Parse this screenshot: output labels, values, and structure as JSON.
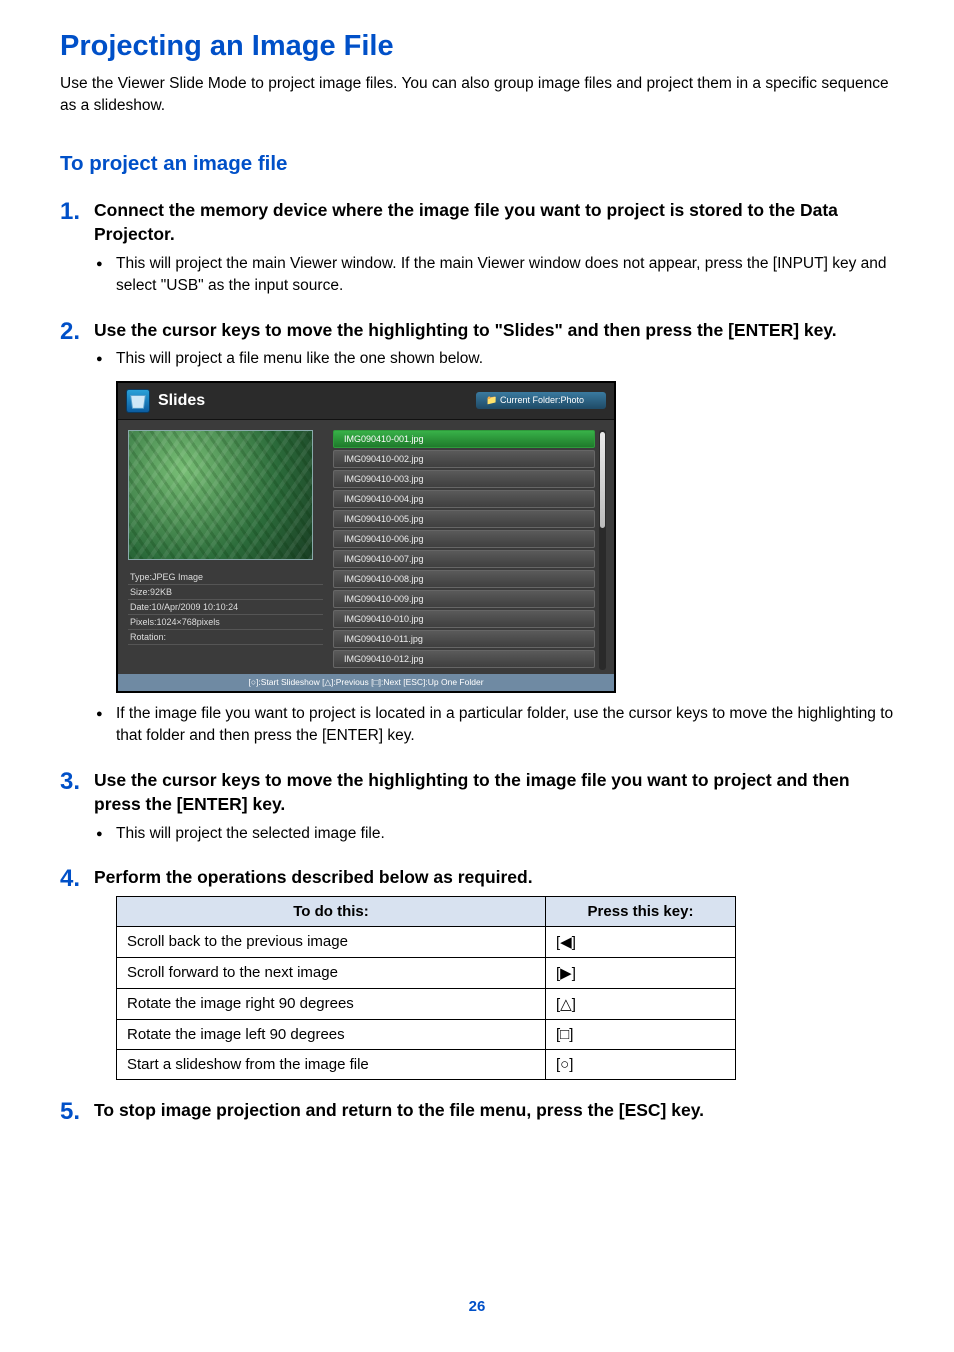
{
  "page": {
    "title": "Projecting an Image File",
    "intro": "Use the Viewer Slide Mode to project image files. You can also group image files and project them in a specific sequence as a slideshow.",
    "subtitle": "To project an image file",
    "page_number": "26"
  },
  "steps": {
    "s1": {
      "num": "1.",
      "title": "Connect the memory device where the image file you want to project is stored to the Data Projector.",
      "b1": "This will project the main Viewer window. If the main Viewer window does not appear, press the [INPUT] key and select \"USB\" as the input source."
    },
    "s2": {
      "num": "2.",
      "title": "Use the cursor keys to move the highlighting to \"Slides\" and then press the [ENTER] key.",
      "b1": "This will project a file menu like the one shown below.",
      "b2": "If the image file you want to project is located in a particular folder, use the cursor keys to move the highlighting to that folder and then press the [ENTER] key."
    },
    "s3": {
      "num": "3.",
      "title": "Use the cursor keys to move the highlighting to the image file you want to project and then press the [ENTER] key.",
      "b1": "This will project the selected image file."
    },
    "s4": {
      "num": "4.",
      "title": "Perform the operations described below as required."
    },
    "s5": {
      "num": "5.",
      "title": "To stop image projection and return to the file menu, press the [ESC] key."
    }
  },
  "viewer": {
    "title": "Slides",
    "breadcrumb_label": "📁 Current Folder:Photo",
    "meta": {
      "type": "Type:JPEG Image",
      "size": "Size:92KB",
      "date": "Date:10/Apr/2009 10:10:24",
      "pixels": "Pixels:1024×768pixels",
      "rotation": "Rotation:"
    },
    "files": [
      "IMG090410-001.jpg",
      "IMG090410-002.jpg",
      "IMG090410-003.jpg",
      "IMG090410-004.jpg",
      "IMG090410-005.jpg",
      "IMG090410-006.jpg",
      "IMG090410-007.jpg",
      "IMG090410-008.jpg",
      "IMG090410-009.jpg",
      "IMG090410-010.jpg",
      "IMG090410-011.jpg",
      "IMG090410-012.jpg"
    ],
    "footer": "[○]:Start Slideshow  [△]:Previous  [□]:Next  [ESC]:Up One Folder"
  },
  "table": {
    "h1": "To do this:",
    "h2": "Press this key:",
    "r1a": "Scroll back to the previous image",
    "r1b": "[◀]",
    "r2a": "Scroll forward to the next image",
    "r2b": "[▶]",
    "r3a": "Rotate the image right 90 degrees",
    "r3b": "[△]",
    "r4a": "Rotate the image left 90 degrees",
    "r4b": "[□]",
    "r5a": "Start a slideshow from the image file",
    "r5b": "[○]"
  }
}
